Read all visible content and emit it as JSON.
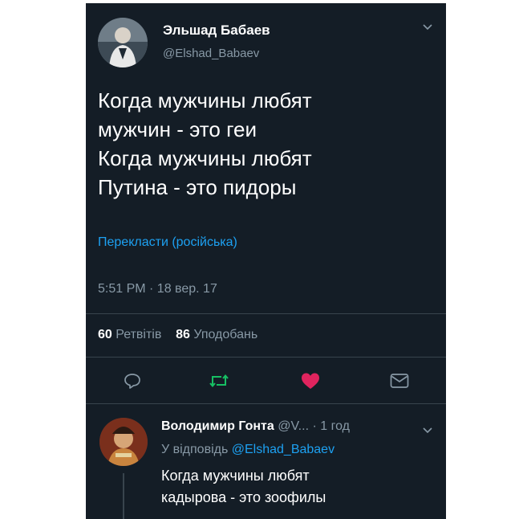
{
  "tweet": {
    "author_name": "Эльшад Бабаев",
    "author_handle": "@Elshad_Babaev",
    "text_lines": [
      "Когда мужчины любят",
      "мужчин - это геи",
      "Когда мужчины любят",
      "Путина - это пидоры"
    ],
    "translate_link": "Перекласти (російська)",
    "timestamp": "5:51 PM · 18 вер. 17",
    "retweets_count": "60",
    "retweets_label": "Ретвітів",
    "likes_count": "86",
    "likes_label": "Уподобань"
  },
  "actions": {
    "icons": [
      "reply-icon",
      "retweet-icon",
      "heart-icon",
      "message-icon"
    ],
    "retweet_color": "#17bf63",
    "like_color": "#e0245e"
  },
  "reply": {
    "author_name": "Володимир Гонта",
    "author_handle_truncated": "@V...",
    "time": "· 1 год",
    "in_reply_to_prefix": "У відповідь",
    "in_reply_to_handle": "@Elshad_Babaev",
    "text_lines": [
      "Когда мужчины любят",
      "кадырова - это зоофилы"
    ]
  },
  "colors": {
    "background": "#141d26",
    "secondary_text": "#8899a6",
    "link": "#1da1f2",
    "divider": "#38444d"
  }
}
